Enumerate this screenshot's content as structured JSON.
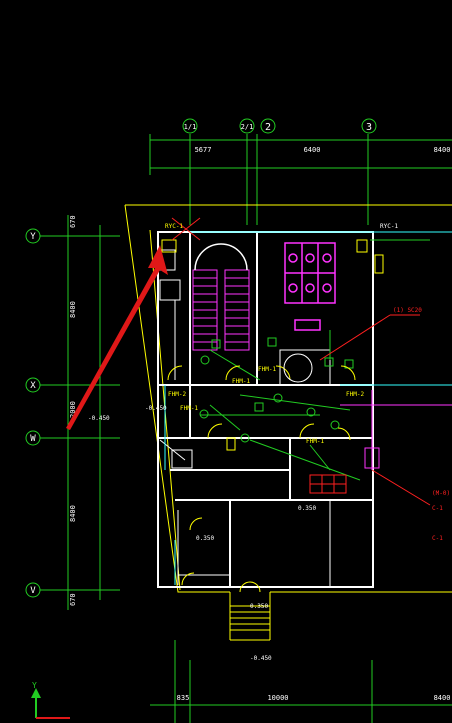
{
  "axes": {
    "top": [
      "1/1",
      "2/1",
      "2",
      "3"
    ],
    "left": [
      "Y",
      "X",
      "W",
      "V"
    ]
  },
  "dims": {
    "top": [
      "5677",
      "6400",
      "8400"
    ],
    "left": [
      "8400",
      "2000",
      "8400"
    ],
    "left_small": [
      "670",
      "670"
    ],
    "bottom": [
      "835",
      "10000",
      "8400"
    ]
  },
  "labels": {
    "ryc1": "RYC-1",
    "ryc2": "RYC-1",
    "elev1": "-0.450",
    "elev2": "-0.450",
    "elev3": "0.350",
    "elev4": "0.350",
    "elev5": "0.350",
    "elev6": "-0.450",
    "note1": "(1) SC20",
    "note2": "(M-0)",
    "note3": "C-1",
    "note4": "C-1",
    "fhm1": "FHM-1",
    "fhm2": "FHM-1",
    "fhm3": "FHM-1",
    "fhm4": "FHM-1",
    "room1": "FHM-2",
    "room2": "FHM-2",
    "hall": "",
    "axis_y": "Y",
    "axis_x": "X"
  },
  "colors": {
    "bg": "#000000",
    "white": "#ffffff",
    "green": "#22cc22",
    "yellow": "#ffff00",
    "red": "#ff2020",
    "magenta": "#ff33ff",
    "cyan": "#33ffff"
  }
}
